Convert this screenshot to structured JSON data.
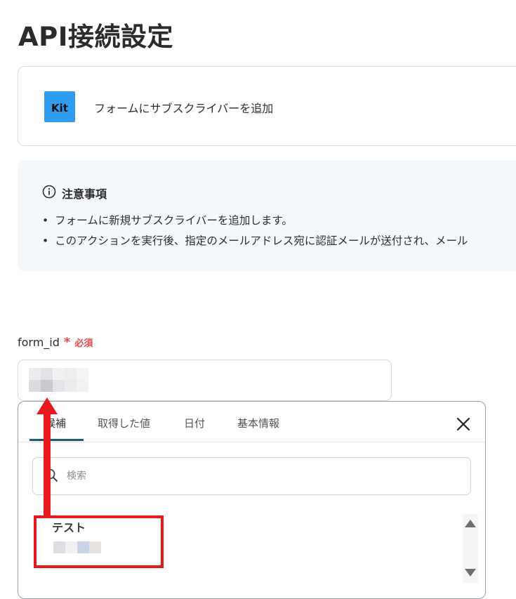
{
  "page": {
    "title": "API接続設定"
  },
  "app": {
    "logo_text": "Kit",
    "action_label": "フォームにサブスクライバーを追加"
  },
  "notice": {
    "title": "注意事項",
    "items": [
      "フォームに新規サブスクライバーを追加します。",
      "このアクションを実行後、指定のメールアドレス宛に認証メールが送付され、メール"
    ]
  },
  "field": {
    "name": "form_id",
    "required_mark": "*",
    "required_text": "必須"
  },
  "dropdown": {
    "tabs": [
      "候補",
      "取得した値",
      "日付",
      "基本情報"
    ],
    "active_tab": "候補",
    "search_placeholder": "検索",
    "options": [
      {
        "title": "テスト"
      }
    ]
  },
  "colors": {
    "kit_blue": "#2f9cf0",
    "required_red": "#e5484d",
    "tab_active": "#1b5d78",
    "annotation_red": "#e8191b"
  },
  "icons": {
    "info": "info-circle-icon",
    "close": "close-icon",
    "search": "search-icon",
    "scroll_up": "triangle-up-icon",
    "scroll_down": "triangle-down-icon"
  }
}
